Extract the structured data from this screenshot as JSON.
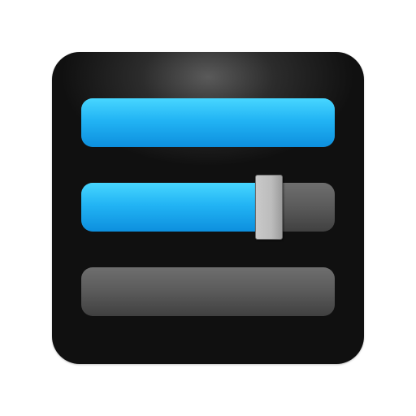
{
  "icon": {
    "name": "settings-sliders-icon",
    "colors": {
      "tile": "#101010",
      "accent_blue": "#22b4f4",
      "track_gray": "#5a5a5a",
      "thumb": "#bcbcbc"
    }
  },
  "sliders": [
    {
      "id": "slider-1",
      "level": 1.0
    },
    {
      "id": "slider-2",
      "level": 0.72,
      "has_thumb": true
    },
    {
      "id": "slider-3",
      "level": 0.0
    }
  ]
}
